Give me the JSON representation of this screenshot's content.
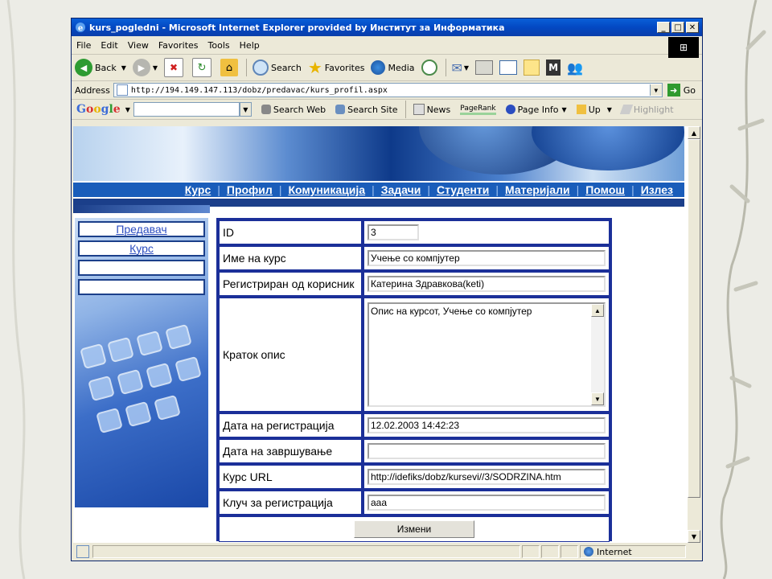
{
  "window": {
    "title": "kurs_pogledni - Microsoft Internet Explorer provided by Институт за Информатика",
    "controls": [
      "_",
      "□",
      "✕"
    ]
  },
  "menu": [
    "File",
    "Edit",
    "View",
    "Favorites",
    "Tools",
    "Help"
  ],
  "toolbar": {
    "back": "Back",
    "search": "Search",
    "favorites": "Favorites",
    "media": "Media"
  },
  "address": {
    "label": "Address",
    "url": "http://194.149.147.113/dobz/predavac/kurs_profil.aspx",
    "go": "Go"
  },
  "googlebar": {
    "logo": "Google",
    "search_web": "Search Web",
    "search_site": "Search Site",
    "news": "News",
    "pagerank": "PageRank",
    "page_info": "Page Info",
    "up": "Up",
    "highlight": "Highlight"
  },
  "nav": [
    "Курс",
    "Профил",
    "Комуникација",
    "Задачи",
    "Студенти",
    "Материјали",
    "Помош",
    "Излез"
  ],
  "sidebar": {
    "items": [
      "Предавач",
      "Курс",
      "",
      ""
    ]
  },
  "form": {
    "id": {
      "label": "ID",
      "value": "3"
    },
    "course_name": {
      "label": "Име на курс",
      "value": "Учење со компјутер"
    },
    "registered_by": {
      "label": "Регистриран од корисник",
      "value": "Катерина Здравкова(keti)"
    },
    "description": {
      "label": "Краток опис",
      "value": "Опис на курсот, Учење со компјутер"
    },
    "registration_date": {
      "label": "Дата на регистрација",
      "value": "12.02.2003 14:42:23"
    },
    "end_date": {
      "label": "Дата на завршување",
      "value": ""
    },
    "course_url": {
      "label": "Курс URL",
      "value": "http://idefiks/dobz/kursevi//3/SODRZINA.htm"
    },
    "reg_key": {
      "label": "Клуч за регистрација",
      "value": "aaa"
    },
    "submit": "Измени"
  },
  "status": {
    "zone": "Internet"
  }
}
